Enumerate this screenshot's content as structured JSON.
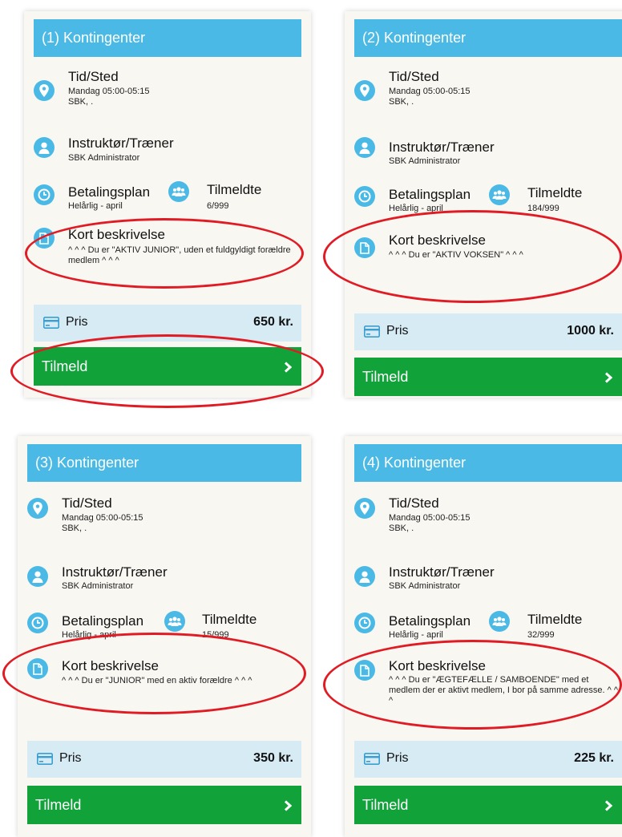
{
  "cards": [
    {
      "title": "(1) Kontingenter",
      "time_label": "Tid/Sted",
      "time_value": "Mandag 05:00-05:15",
      "place_value": "SBK, .",
      "instructor_label": "Instruktør/Træner",
      "instructor_value": "SBK Administrator",
      "payment_label": "Betalingsplan",
      "payment_value": "Helårlig - april",
      "enrolled_label": "Tilmeldte",
      "enrolled_value": "6/999",
      "desc_label": "Kort beskrivelse",
      "desc_value": "^ ^ ^ Du er \"AKTIV JUNIOR\", uden et fuldgyldigt forældre medlem ^ ^ ^",
      "price_label": "Pris",
      "price_value": "650 kr.",
      "signup_label": "Tilmeld"
    },
    {
      "title": "(2) Kontingenter",
      "time_label": "Tid/Sted",
      "time_value": "Mandag 05:00-05:15",
      "place_value": "SBK, .",
      "instructor_label": "Instruktør/Træner",
      "instructor_value": "SBK Administrator",
      "payment_label": "Betalingsplan",
      "payment_value": "Helårlig - april",
      "enrolled_label": "Tilmeldte",
      "enrolled_value": "184/999",
      "desc_label": "Kort beskrivelse",
      "desc_value": "^ ^ ^ Du er \"AKTIV VOKSEN\" ^ ^ ^",
      "price_label": "Pris",
      "price_value": "1000 kr.",
      "signup_label": "Tilmeld"
    },
    {
      "title": "(3) Kontingenter",
      "time_label": "Tid/Sted",
      "time_value": "Mandag 05:00-05:15",
      "place_value": "SBK, .",
      "instructor_label": "Instruktør/Træner",
      "instructor_value": "SBK Administrator",
      "payment_label": "Betalingsplan",
      "payment_value": "Helårlig - april",
      "enrolled_label": "Tilmeldte",
      "enrolled_value": "15/999",
      "desc_label": "Kort beskrivelse",
      "desc_value": "^ ^ ^ Du er \"JUNIOR\" med en aktiv forældre ^ ^ ^",
      "price_label": "Pris",
      "price_value": "350 kr.",
      "signup_label": "Tilmeld"
    },
    {
      "title": "(4) Kontingenter",
      "time_label": "Tid/Sted",
      "time_value": "Mandag 05:00-05:15",
      "place_value": "SBK, .",
      "instructor_label": "Instruktør/Træner",
      "instructor_value": "SBK Administrator",
      "payment_label": "Betalingsplan",
      "payment_value": "Helårlig - april",
      "enrolled_label": "Tilmeldte",
      "enrolled_value": "32/999",
      "desc_label": "Kort beskrivelse",
      "desc_value": "^ ^ ^ Du er \"ÆGTEFÆLLE / SAMBOENDE\" med et medlem der er aktivt medlem, I bor på samme adresse. ^ ^ ^",
      "price_label": "Pris",
      "price_value": "225 kr.",
      "signup_label": "Tilmeld"
    }
  ],
  "colors": {
    "header": "#4ab9e5",
    "card_bg": "#f9f7f2",
    "price_bg": "#d7ebf5",
    "signup_bg": "#11a23a",
    "annotation": "#e01b24"
  },
  "icons": [
    "location-pin-icon",
    "person-icon",
    "clock-icon",
    "group-icon",
    "document-icon",
    "credit-card-icon",
    "chevron-right-icon"
  ]
}
